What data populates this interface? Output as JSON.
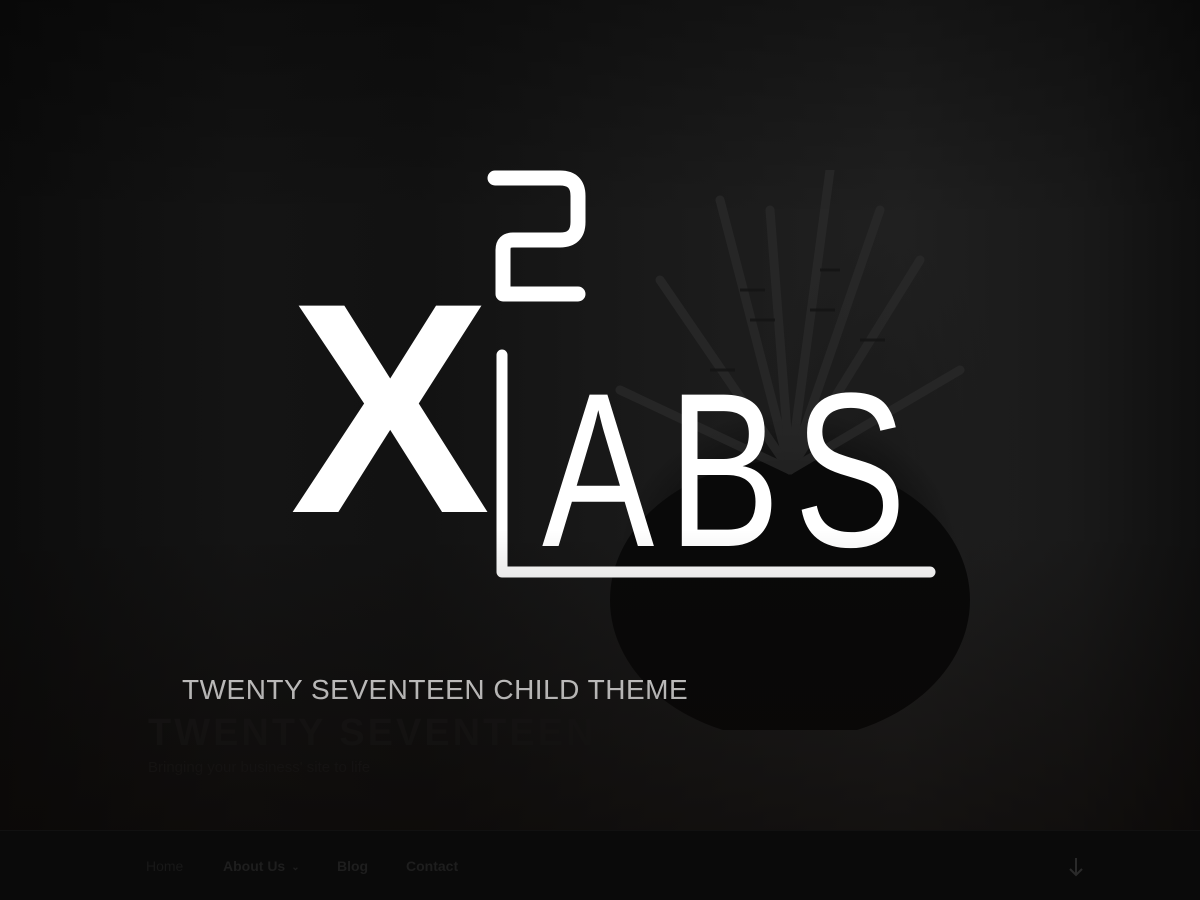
{
  "hero": {
    "child_theme_label": "TWENTY SEVENTEEN CHILD THEME"
  },
  "site": {
    "title": "TWENTY SEVENTEEN",
    "description": "Bringing your business' site to life"
  },
  "logo": {
    "base": "X",
    "superscript": "2",
    "word": "ABS"
  },
  "nav": {
    "items": [
      {
        "label": "Home"
      },
      {
        "label": "About Us"
      },
      {
        "label": "Blog"
      },
      {
        "label": "Contact"
      }
    ],
    "scroll_icon": "arrow-down-icon"
  },
  "colors": {
    "logo": "#ffffff",
    "nav_bg": "#0a0a0a",
    "hero_bg": "#121212"
  }
}
